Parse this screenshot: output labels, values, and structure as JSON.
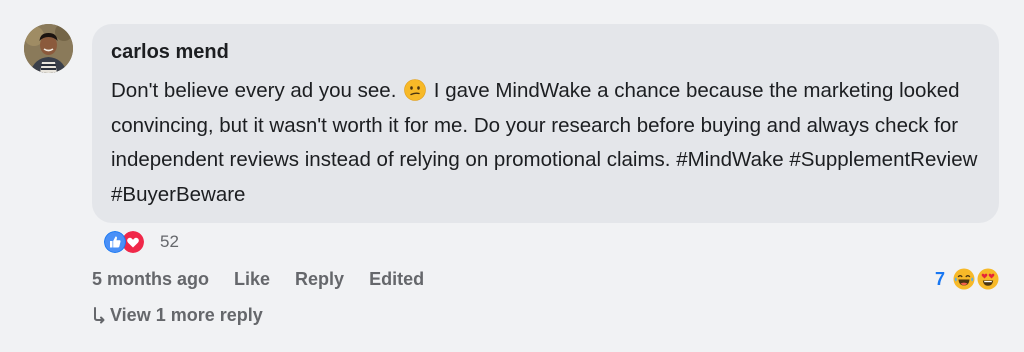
{
  "comment": {
    "author": "carlos mend",
    "text_part1": "Don't believe every ad you see.",
    "text_part2": "I gave MindWake a chance because the marketing looked convincing, but it wasn't worth it for me. Do your research before buying and always check for independent reviews instead of relying on promotional claims. #MindWake #SupplementReview #BuyerBeware",
    "inline_emoji": "confused-face-icon"
  },
  "reactions": {
    "types": [
      "like-reaction-icon",
      "love-reaction-icon"
    ],
    "count": "52"
  },
  "actions": {
    "timestamp": "5 months ago",
    "like_label": "Like",
    "reply_label": "Reply",
    "edited_label": "Edited"
  },
  "reply_reactions": {
    "count": "7",
    "types": [
      "laughing-face-icon",
      "heart-eyes-face-icon"
    ]
  },
  "replies": {
    "view_more_label": "View 1 more reply"
  },
  "colors": {
    "background": "#f1f2f4",
    "bubble": "#e4e6ea",
    "text_primary": "#1c1e21",
    "text_secondary": "#65676b",
    "accent_blue": "#1877f2"
  }
}
